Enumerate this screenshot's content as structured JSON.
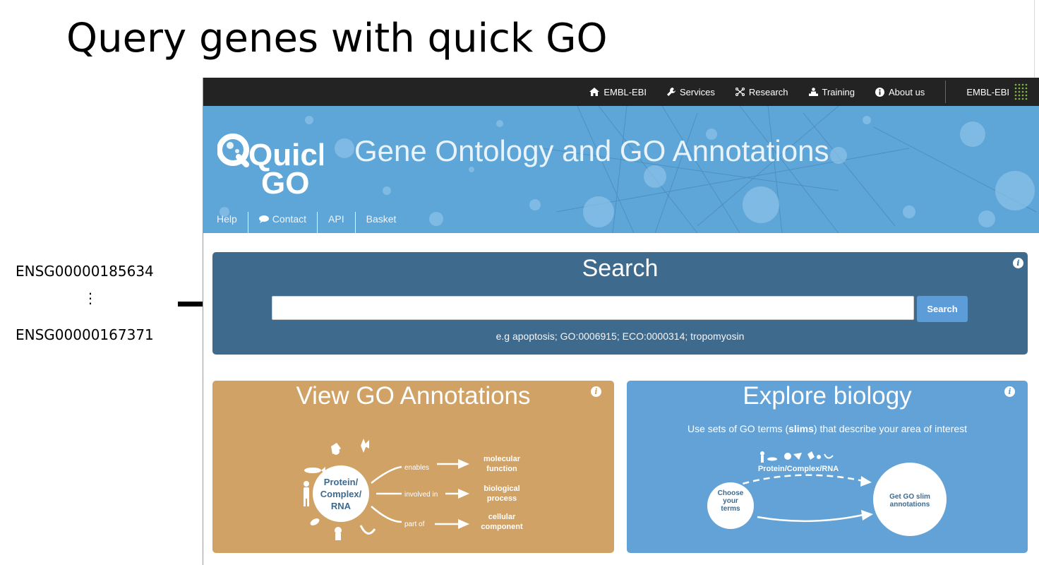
{
  "slide": {
    "title": "Query genes with quick GO",
    "genes": [
      "ENSG00000185634",
      "ENSG00000167371"
    ],
    "ellipsis": "⋮"
  },
  "topnav": {
    "items": [
      {
        "label": "EMBL-EBI",
        "icon": "home-icon"
      },
      {
        "label": "Services",
        "icon": "wrench-icon"
      },
      {
        "label": "Research",
        "icon": "research-icon"
      },
      {
        "label": "Training",
        "icon": "training-icon"
      },
      {
        "label": "About us",
        "icon": "info-icon"
      }
    ],
    "brand": "EMBL-EBI"
  },
  "hero": {
    "logo_text_1": "Quick",
    "logo_text_2": "GO",
    "title": "Gene Ontology and GO Annotations",
    "nav": [
      "Help",
      "Contact",
      "API",
      "Basket"
    ]
  },
  "search": {
    "title": "Search",
    "input_value": "",
    "button_label": "Search",
    "hint": "e.g apoptosis; GO:0006915; ECO:0000314; tropomyosin"
  },
  "annotations_card": {
    "title": "View GO Annotations",
    "center_label": [
      "Protein/",
      "Complex/",
      "RNA"
    ],
    "relations": [
      "enables",
      "involved in",
      "part of"
    ],
    "aspects": [
      [
        "molecular",
        "function"
      ],
      [
        "biological",
        "process"
      ],
      [
        "cellular",
        "component"
      ]
    ]
  },
  "biology_card": {
    "title": "Explore biology",
    "subtitle_pre": "Use sets of GO terms (",
    "subtitle_bold": "slims",
    "subtitle_post": ") that describe your area of interest",
    "entity_label": "Protein/Complex/RNA",
    "left_circle": [
      "Choose",
      "your",
      "terms"
    ],
    "right_circle": [
      "Get GO slim",
      "annotations"
    ]
  },
  "colors": {
    "topbar": "#232323",
    "hero": "#5ea6d8",
    "search_panel": "#3e6a8e",
    "search_button": "#5b9cd9",
    "annotations_card": "#d1a265",
    "biology_card": "#62a2d6"
  }
}
